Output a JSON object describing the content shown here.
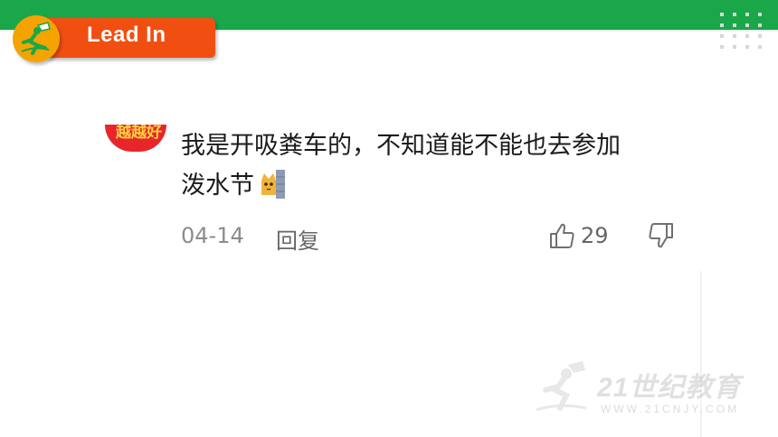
{
  "header": {
    "badge_label": "Lead In",
    "accent_green": "#1aa749",
    "badge_orange": "#f14f12",
    "logo_color": "#f5a300"
  },
  "comment": {
    "avatar_text": "越越好",
    "text_line1": "我是开吸粪车的，不知道能不能也去参加",
    "text_line2": "泼水节",
    "emoji": "peeking-cat-emoji",
    "date": "04-14",
    "reply_label": "回复",
    "like_count": "29"
  },
  "watermark": {
    "brand": "21世纪教育",
    "site": "WWW.21CNJY.COM"
  }
}
